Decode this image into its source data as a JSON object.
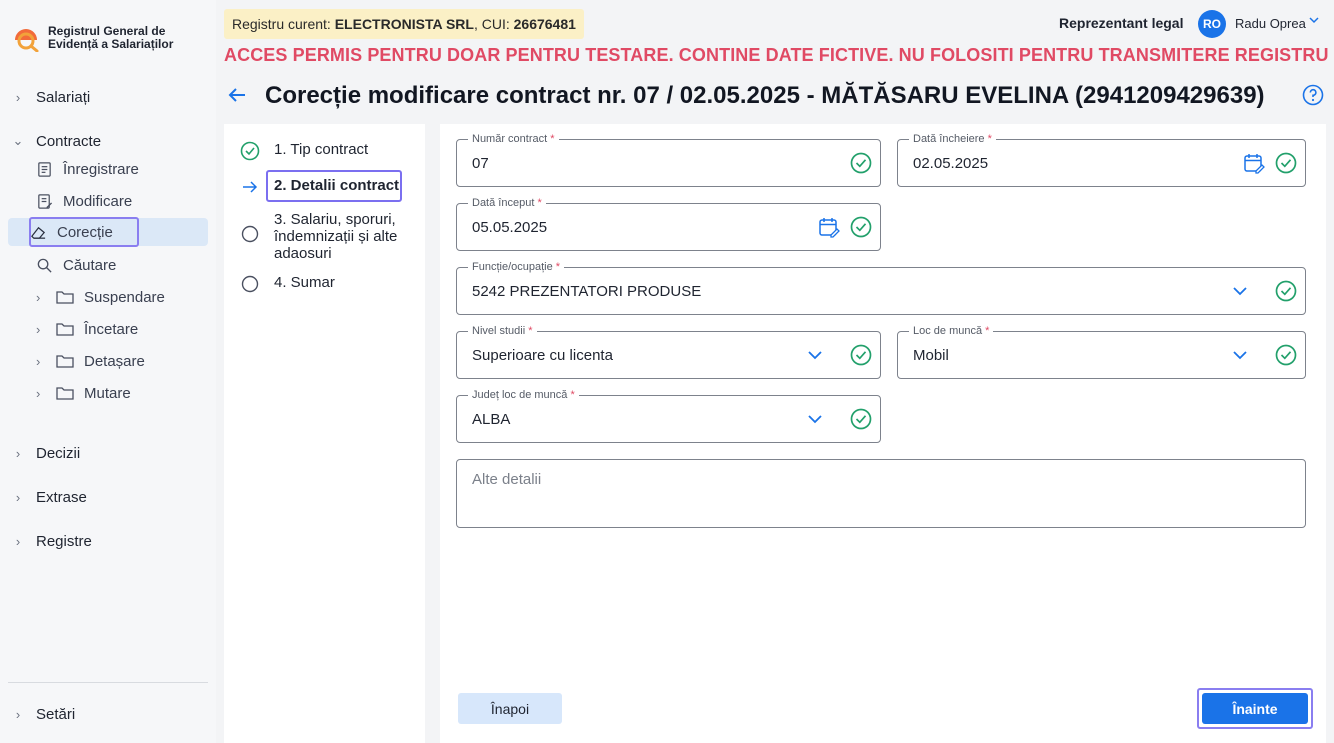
{
  "app": {
    "logo_text": "Registrul General de Evidență a Salariaților",
    "registry_prefix": "Registru curent: ",
    "registry_company": "ELECTRONISTA SRL",
    "registry_cui_prefix": ", CUI: ",
    "registry_cui": "26676481",
    "warning": "ACCES PERMIS PENTRU DOAR PENTRU TESTARE. CONTINE DATE FICTIVE. NU FOLOSITI PENTRU TRANSMITERE REGISTRU",
    "role": "Reprezentant legal",
    "user_initials": "RO",
    "user_name": "Radu Oprea"
  },
  "sidebar": {
    "salariati": "Salariați",
    "contracte": "Contracte",
    "sub": {
      "inregistrare": "Înregistrare",
      "modificare": "Modificare",
      "corectie": "Corecție",
      "cautare": "Căutare"
    },
    "folders": {
      "suspendare": "Suspendare",
      "incetare": "Încetare",
      "detasare": "Detașare",
      "mutare": "Mutare"
    },
    "decizii": "Decizii",
    "extrase": "Extrase",
    "registre": "Registre",
    "setari": "Setări"
  },
  "page": {
    "title": "Corecție modificare contract nr. 07 / 02.05.2025 - MĂTĂSARU  EVELINA (2941209429639)"
  },
  "steps": [
    {
      "label": "1. Tip contract",
      "state": "done"
    },
    {
      "label": "2. Detalii contract",
      "state": "current"
    },
    {
      "label": "3. Salariu, sporuri, îndemnizații și alte adaosuri",
      "state": "pending"
    },
    {
      "label": "4. Sumar",
      "state": "pending"
    }
  ],
  "form": {
    "numar_contract": {
      "label": "Număr contract",
      "value": "07"
    },
    "data_incheiere": {
      "label": "Dată încheiere",
      "value": "02.05.2025"
    },
    "data_inceput": {
      "label": "Dată început",
      "value": "05.05.2025"
    },
    "functie": {
      "label": "Funcție/ocupație",
      "value": "5242 PREZENTATORI PRODUSE"
    },
    "nivel_studii": {
      "label": "Nivel studii",
      "value": "Superioare cu licenta"
    },
    "loc_munca": {
      "label": "Loc de muncă",
      "value": "Mobil"
    },
    "judet": {
      "label": "Județ loc de muncă",
      "value": "ALBA"
    },
    "alte_detalii_placeholder": "Alte detalii",
    "required_mark": "*"
  },
  "buttons": {
    "back": "Înapoi",
    "next": "Înainte"
  },
  "colors": {
    "primary": "#1a73e8",
    "valid": "#22a06b",
    "warning": "#e04a64",
    "highlight": "#8a7ef0"
  }
}
